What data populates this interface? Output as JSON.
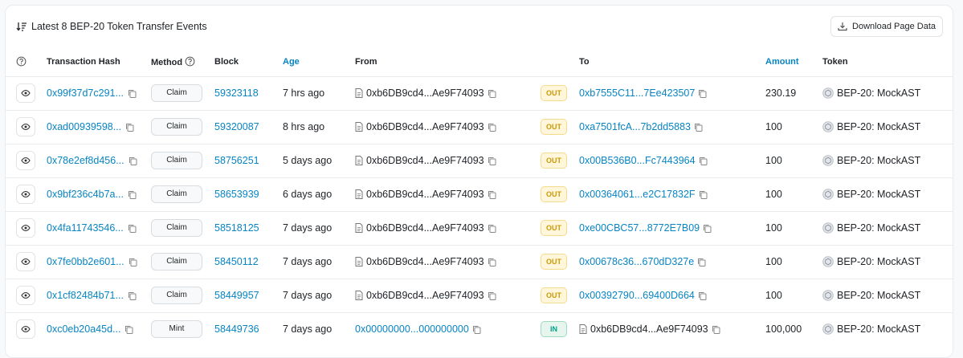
{
  "header": {
    "title": "Latest 8 BEP-20 Token Transfer Events",
    "download_label": "Download Page Data"
  },
  "columns": {
    "hash": "Transaction Hash",
    "method": "Method",
    "block": "Block",
    "age": "Age",
    "from": "From",
    "to": "To",
    "amount": "Amount",
    "token": "Token"
  },
  "colors": {
    "link": "#0784c3",
    "out": "#cc9a06",
    "in": "#00a186"
  },
  "rows": [
    {
      "hash": "0x99f37d7c291...",
      "method": "Claim",
      "block": "59323118",
      "age": "7 hrs ago",
      "from": "0xb6DB9cd4...Ae9F74093",
      "from_is_contract": true,
      "dir": "OUT",
      "to": "0xb7555C11...7Ee423507",
      "to_is_contract": false,
      "amount": "230.19",
      "token": "BEP-20: MockAST"
    },
    {
      "hash": "0xad00939598...",
      "method": "Claim",
      "block": "59320087",
      "age": "8 hrs ago",
      "from": "0xb6DB9cd4...Ae9F74093",
      "from_is_contract": true,
      "dir": "OUT",
      "to": "0xa7501fcA...7b2dd5883",
      "to_is_contract": false,
      "amount": "100",
      "token": "BEP-20: MockAST"
    },
    {
      "hash": "0x78e2ef8d456...",
      "method": "Claim",
      "block": "58756251",
      "age": "5 days ago",
      "from": "0xb6DB9cd4...Ae9F74093",
      "from_is_contract": true,
      "dir": "OUT",
      "to": "0x00B536B0...Fc7443964",
      "to_is_contract": false,
      "amount": "100",
      "token": "BEP-20: MockAST"
    },
    {
      "hash": "0x9bf236c4b7a...",
      "method": "Claim",
      "block": "58653939",
      "age": "6 days ago",
      "from": "0xb6DB9cd4...Ae9F74093",
      "from_is_contract": true,
      "dir": "OUT",
      "to": "0x00364061...e2C17832F",
      "to_is_contract": false,
      "amount": "100",
      "token": "BEP-20: MockAST"
    },
    {
      "hash": "0x4fa11743546...",
      "method": "Claim",
      "block": "58518125",
      "age": "7 days ago",
      "from": "0xb6DB9cd4...Ae9F74093",
      "from_is_contract": true,
      "dir": "OUT",
      "to": "0xe00CBC57...8772E7B09",
      "to_is_contract": false,
      "amount": "100",
      "token": "BEP-20: MockAST"
    },
    {
      "hash": "0x7fe0bb2e601...",
      "method": "Claim",
      "block": "58450112",
      "age": "7 days ago",
      "from": "0xb6DB9cd4...Ae9F74093",
      "from_is_contract": true,
      "dir": "OUT",
      "to": "0x00678c36...670dD327e",
      "to_is_contract": false,
      "amount": "100",
      "token": "BEP-20: MockAST"
    },
    {
      "hash": "0x1cf82484b71...",
      "method": "Claim",
      "block": "58449957",
      "age": "7 days ago",
      "from": "0xb6DB9cd4...Ae9F74093",
      "from_is_contract": true,
      "dir": "OUT",
      "to": "0x00392790...69400D664",
      "to_is_contract": false,
      "amount": "100",
      "token": "BEP-20: MockAST"
    },
    {
      "hash": "0xc0eb20a45d...",
      "method": "Mint",
      "block": "58449736",
      "age": "7 days ago",
      "from": "0x00000000...000000000",
      "from_is_contract": false,
      "dir": "IN",
      "to": "0xb6DB9cd4...Ae9F74093",
      "to_is_contract": true,
      "amount": "100,000",
      "token": "BEP-20: MockAST"
    }
  ]
}
